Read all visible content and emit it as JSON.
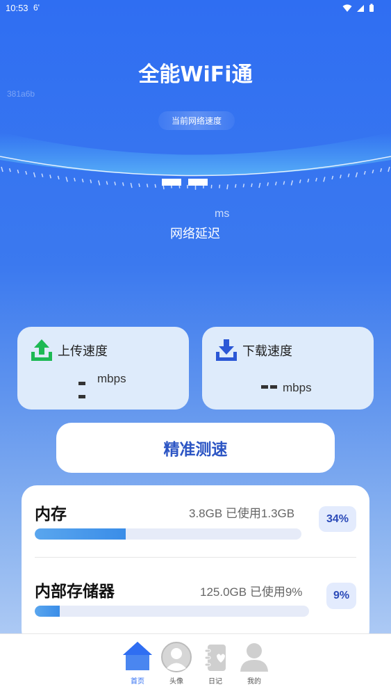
{
  "status_bar": {
    "time": "10:53",
    "extra": "6'"
  },
  "header": {
    "title": "全能WiFi通",
    "build_tag": "381a6b",
    "speed_chip": "当前网络速度"
  },
  "gauge": {
    "latency_unit": "ms",
    "latency_label": "网络延迟"
  },
  "upload": {
    "title": "上传速度",
    "unit": "mbps"
  },
  "download": {
    "title": "下载速度",
    "unit": "mbps"
  },
  "test_button": {
    "label": "精准测速"
  },
  "storage": {
    "memory": {
      "name": "内存",
      "stat": "3.8GB 已使用1.3GB",
      "percent_label": "34%",
      "percent": 34
    },
    "internal": {
      "name": "内部存储器",
      "stat": "125.0GB 已使用9%",
      "percent_label": "9%",
      "percent": 9
    }
  },
  "nav": {
    "items": [
      {
        "label": "首页",
        "icon": "home-icon",
        "active": true
      },
      {
        "label": "头像",
        "icon": "avatar-icon",
        "active": false
      },
      {
        "label": "日记",
        "icon": "diary-icon",
        "active": false
      },
      {
        "label": "我的",
        "icon": "profile-icon",
        "active": false
      }
    ]
  },
  "colors": {
    "accent": "#2f6ef2",
    "button_text": "#2c55c4",
    "upload_icon": "#1db954",
    "download_icon": "#2b57d6"
  }
}
